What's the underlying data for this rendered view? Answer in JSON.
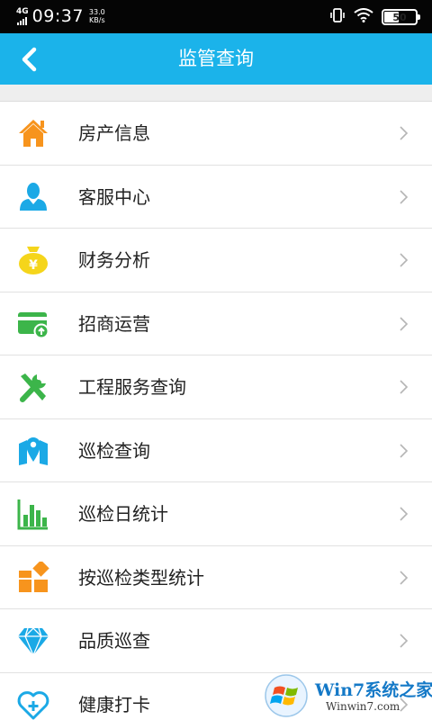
{
  "status_bar": {
    "network": "4G",
    "time": "09:37",
    "speed_value": "33.0",
    "speed_unit": "KB/s",
    "battery_level": "50"
  },
  "header": {
    "title": "监管查询",
    "back_icon": "chevron-left-icon"
  },
  "colors": {
    "app_bar": "#1bb3ea",
    "orange": "#f7941d",
    "blue": "#1ba9e6",
    "yellow": "#f5d51b",
    "green": "#3cb54a"
  },
  "menu": {
    "items": [
      {
        "label": "房产信息",
        "icon": "house-icon"
      },
      {
        "label": "客服中心",
        "icon": "person-icon"
      },
      {
        "label": "财务分析",
        "icon": "money-bag-icon"
      },
      {
        "label": "招商运营",
        "icon": "card-icon"
      },
      {
        "label": "工程服务查询",
        "icon": "tools-icon"
      },
      {
        "label": "巡检查询",
        "icon": "map-pin-icon"
      },
      {
        "label": "巡检日统计",
        "icon": "bar-chart-icon"
      },
      {
        "label": "按巡检类型统计",
        "icon": "grid-icon"
      },
      {
        "label": "品质巡查",
        "icon": "diamond-icon"
      },
      {
        "label": "健康打卡",
        "icon": "heart-plus-icon"
      }
    ]
  },
  "watermark": {
    "text": "Win7系统之家",
    "url": "Winwin7.com"
  }
}
